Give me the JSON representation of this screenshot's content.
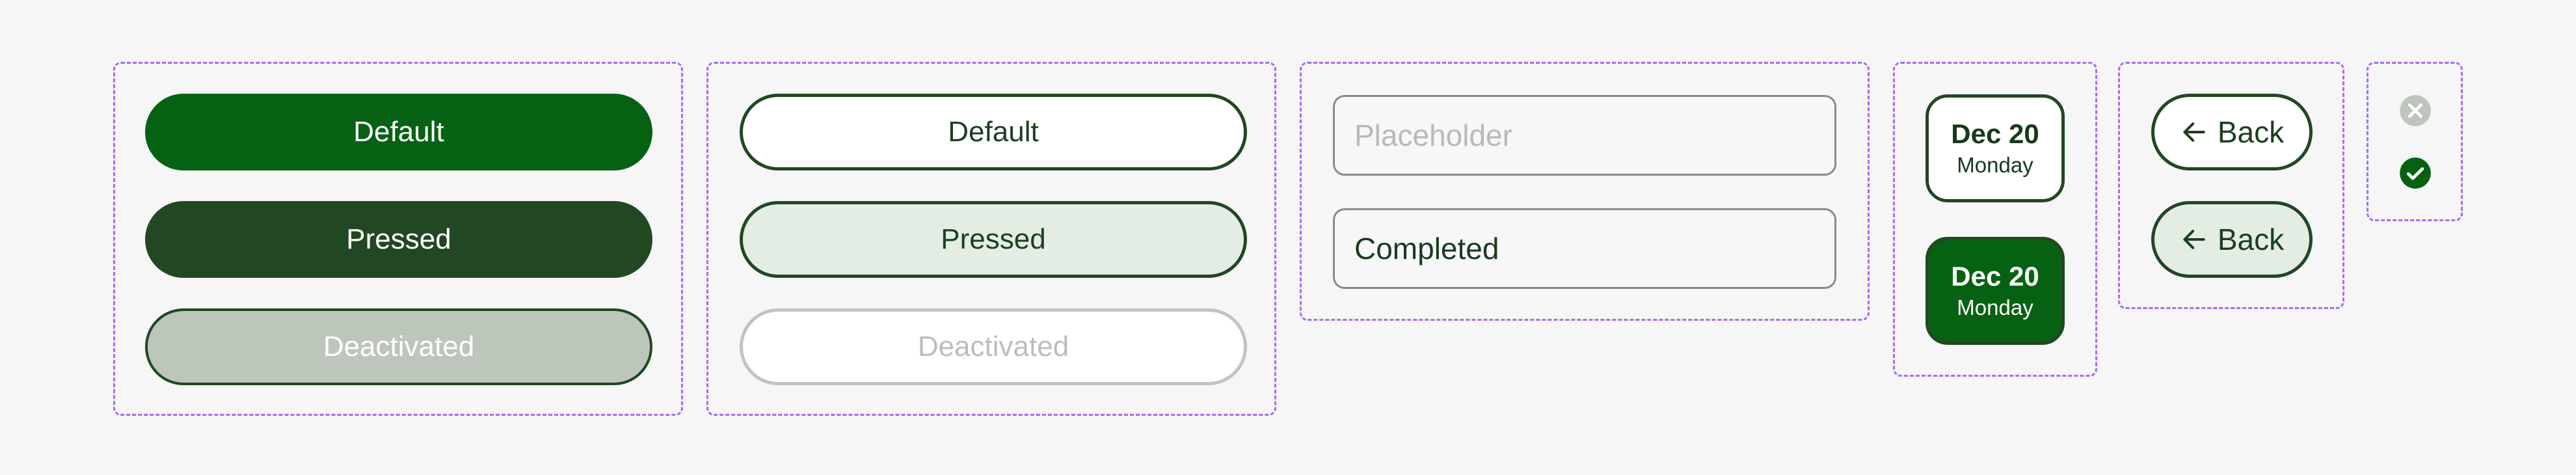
{
  "primary_buttons": {
    "default": "Default",
    "pressed": "Pressed",
    "deactivated": "Deactivated"
  },
  "secondary_buttons": {
    "default": "Default",
    "pressed": "Pressed",
    "deactivated": "Deactivated"
  },
  "inputs": {
    "placeholder": "Placeholder",
    "completed": "Completed"
  },
  "date_chips": [
    {
      "date": "Dec 20",
      "day": "Monday",
      "state": "default"
    },
    {
      "date": "Dec 20",
      "day": "Monday",
      "state": "selected"
    }
  ],
  "back_buttons": {
    "default": "Back",
    "pressed": "Back"
  },
  "status_icons": [
    "close-circle-icon",
    "check-circle-icon"
  ],
  "colors": {
    "primary": "#066212",
    "pressed": "#214723",
    "disabled_fill": "#bcc6bb",
    "pressed_light": "#e4ede4",
    "dashed_border": "#a66cf0"
  }
}
